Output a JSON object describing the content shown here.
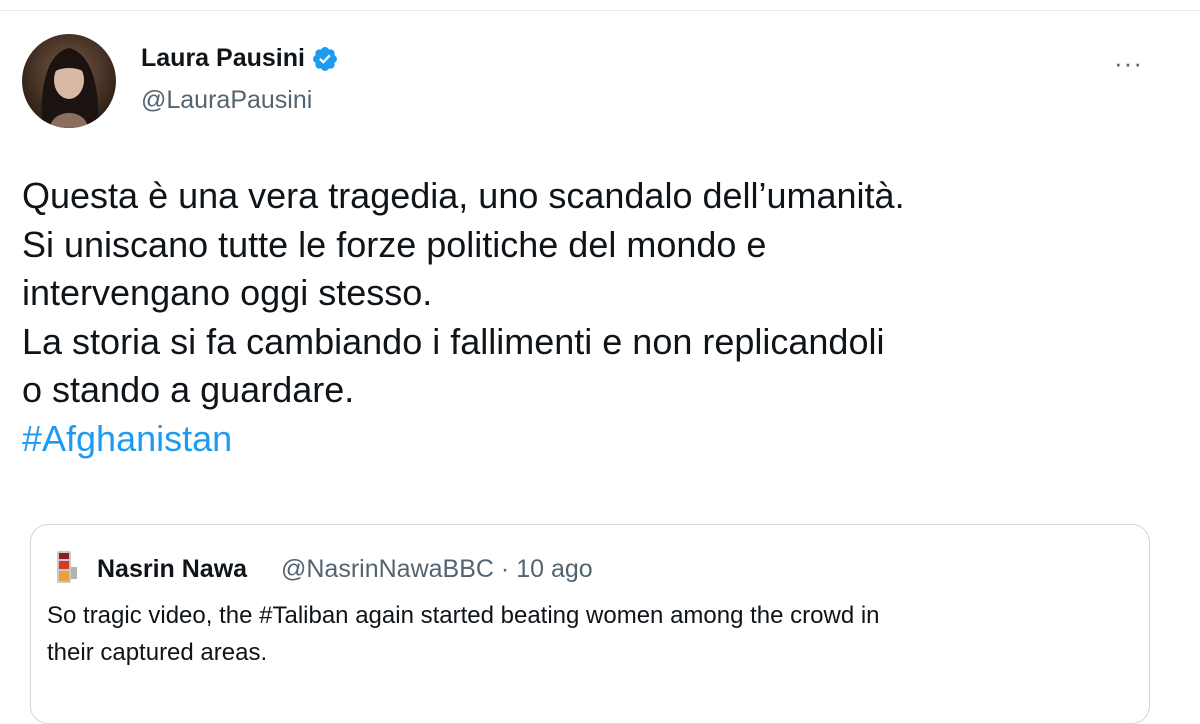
{
  "tweet": {
    "author": {
      "name": "Laura Pausini",
      "handle": "@LauraPausini",
      "verified": true,
      "avatar_icon": "profile-photo"
    },
    "more_icon": "more-options-icon",
    "more_label": "···",
    "text_lines": [
      "Questa è una vera tragedia, uno scandalo dell’umanità.",
      "Si uniscano tutte le forze politiche del mondo e",
      "intervengano oggi stesso.",
      "La storia si fa cambiando i fallimenti e non replicandoli",
      "o stando a guardare."
    ],
    "hashtag": "#Afghanistan"
  },
  "quoted_tweet": {
    "author_name": "Nasrin Nawa",
    "handle": "@NasrinNawaBBC",
    "separator": "·",
    "time": "10 ago",
    "text_lines": [
      "So tragic video, the #Taliban again started beating women among the crowd in",
      "their captured areas."
    ]
  },
  "colors": {
    "accent": "#1d9bf0",
    "text": "#0f1419",
    "secondary": "#536471",
    "border": "#cfd9de"
  }
}
